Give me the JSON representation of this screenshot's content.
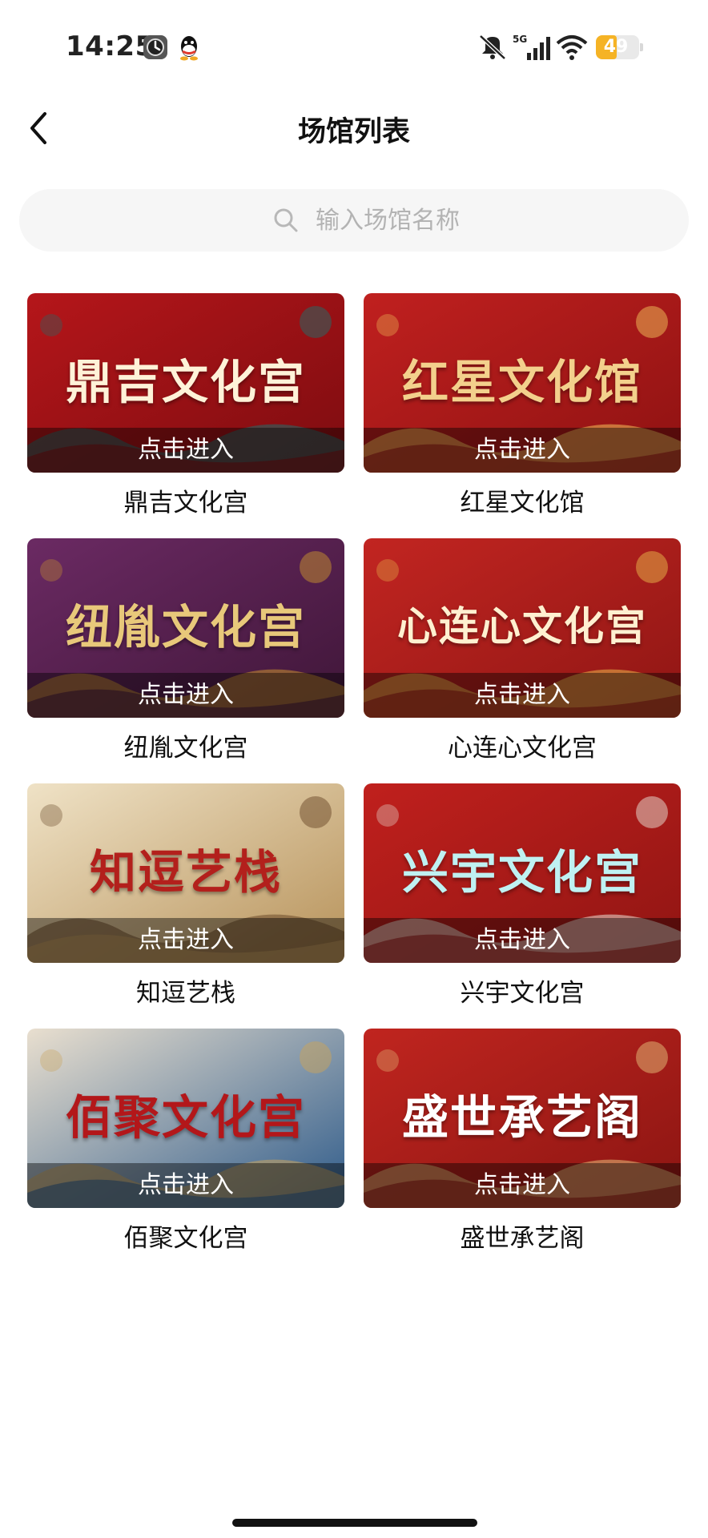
{
  "status_bar": {
    "time": "14:25",
    "network": "5G",
    "battery": "49",
    "battery_fraction": 0.49,
    "icons": [
      "clock-icon",
      "qq-icon",
      "mute-icon",
      "signal-5g-icon",
      "wifi-icon",
      "battery-icon"
    ]
  },
  "header": {
    "back_icon": "chevron-left-icon",
    "title": "场馆列表"
  },
  "search": {
    "icon": "search-icon",
    "placeholder": "输入场馆名称",
    "value": ""
  },
  "venues": [
    {
      "banner_title": "鼎吉文化宫",
      "enter_label": "点击进入",
      "name": "鼎吉文化宫",
      "theme": {
        "bg1": "#b5161a",
        "bg2": "#7d0c10",
        "text": "#fff2d8",
        "accent": "#1f6e6a"
      }
    },
    {
      "banner_title": "红星文化馆",
      "enter_label": "点击进入",
      "name": "红星文化馆",
      "theme": {
        "bg1": "#c0201f",
        "bg2": "#8e1212",
        "text": "#f3d08c",
        "accent": "#f2c15a"
      }
    },
    {
      "banner_title": "纽胤文化宫",
      "enter_label": "点击进入",
      "name": "纽胤文化宫",
      "theme": {
        "bg1": "#6b2a63",
        "bg2": "#3f1638",
        "text": "#e8c87a",
        "accent": "#c8922e"
      }
    },
    {
      "banner_title": "心连心文化宫",
      "enter_label": "点击进入",
      "name": "心连心文化宫",
      "theme": {
        "bg1": "#c22521",
        "bg2": "#8f1614",
        "text": "#fff0d0",
        "accent": "#e9b84a"
      }
    },
    {
      "banner_title": "知逗艺栈",
      "enter_label": "点击进入",
      "name": "知逗艺栈",
      "theme": {
        "bg1": "#efe2c6",
        "bg2": "#b7925a",
        "text": "#b3201c",
        "accent": "#6b4a2a"
      }
    },
    {
      "banner_title": "兴宇文化宫",
      "enter_label": "点击进入",
      "name": "兴宇文化宫",
      "theme": {
        "bg1": "#c0201d",
        "bg2": "#901513",
        "text": "#bff1f2",
        "accent": "#e8e2d6"
      }
    },
    {
      "banner_title": "佰聚文化宫",
      "enter_label": "点击进入",
      "name": "佰聚文化宫",
      "theme": {
        "bg1": "#e9dfcf",
        "bg2": "#2d5a8a",
        "text": "#b3171a",
        "accent": "#c9a35b"
      }
    },
    {
      "banner_title": "盛世承艺阁",
      "enter_label": "点击进入",
      "name": "盛世承艺阁",
      "theme": {
        "bg1": "#c0251f",
        "bg2": "#8b1512",
        "text": "#ffffff",
        "accent": "#e6c07a"
      }
    }
  ]
}
